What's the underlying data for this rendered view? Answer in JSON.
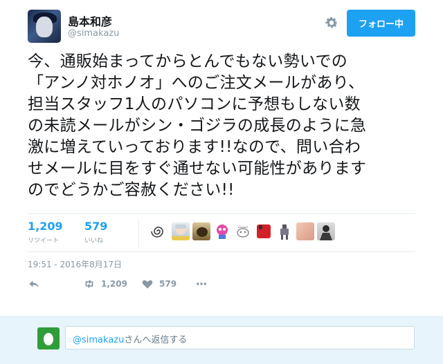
{
  "user": {
    "name": "島本和彦",
    "handle": "@simakazu",
    "follow_label": "フォロー中"
  },
  "tweet": {
    "text": "今、通販始まってからとんでもない勢いでの\n「アンノ対ホノオ」へのご注文メールがあり、\n担当スタッフ1人のパソコンに予想もしない数\nの未読メールがシン・ゴジラの成長のように急\n激に増えていっております!!なので、問い合わ\nせメールに目をすぐ通せない可能性があります\nのでどうかご容赦ください!!",
    "timestamp": "19:51 - 2016年8月17日"
  },
  "stats": {
    "retweets_count": "1,209",
    "retweets_label": "リツイート",
    "likes_count": "579",
    "likes_label": "いいね"
  },
  "likers": [
    {
      "icon": "swirl-avatar-icon"
    },
    {
      "icon": "anime-girl-avatar-icon"
    },
    {
      "icon": "dog-avatar-icon"
    },
    {
      "icon": "pink-creature-avatar-icon"
    },
    {
      "icon": "sketch-avatar-icon"
    },
    {
      "icon": "red-avatar-icon"
    },
    {
      "icon": "robot-avatar-icon"
    },
    {
      "icon": "skin-avatar-icon"
    },
    {
      "icon": "dark-figure-avatar-icon"
    }
  ],
  "actions": {
    "retweet_count": "1,209",
    "like_count": "579"
  },
  "reply": {
    "mention": "@simakazu",
    "suffix": "さんへ返信する"
  },
  "colors": {
    "accent": "#1da1f2",
    "muted": "#8899a6",
    "reply_bg": "#e8f4fb"
  }
}
